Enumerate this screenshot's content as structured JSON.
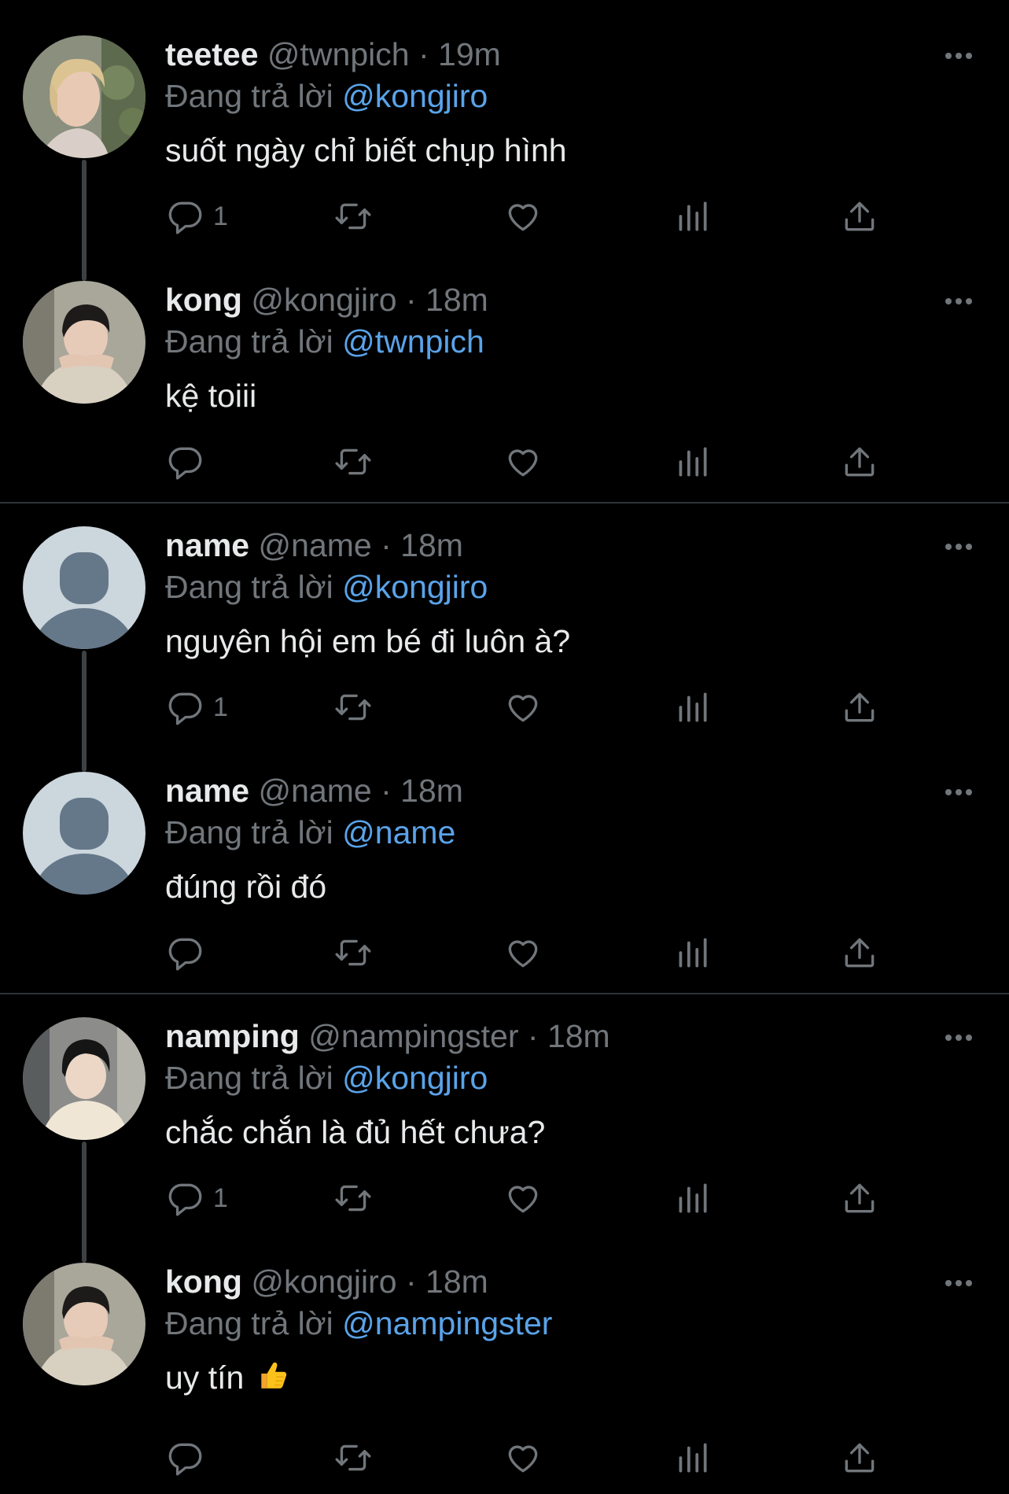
{
  "theme": {
    "background": "#000000",
    "text": "#e7e9ea",
    "muted": "#71767b",
    "link": "#5aa3e9",
    "thread_line": "#3e4144",
    "separator": "#2f3336"
  },
  "reply_prefix": "Đang trả lời",
  "tweets": [
    {
      "name": "teetee",
      "handle": "@twnpich",
      "time": "19m",
      "reply_to": "@kongjiro",
      "text": "suốt ngày chỉ biết chụp hình",
      "reply_count": "1",
      "avatar_icon": "photo-avatar-icon"
    },
    {
      "name": "kong",
      "handle": "@kongjiro",
      "time": "18m",
      "reply_to": "@twnpich",
      "text": "kệ toiii",
      "reply_count": "",
      "avatar_icon": "photo-avatar-icon"
    },
    {
      "name": "name",
      "handle": "@name",
      "time": "18m",
      "reply_to": "@kongjiro",
      "text": "nguyên hội em bé đi luôn à?",
      "reply_count": "1",
      "avatar_icon": "default-avatar-icon"
    },
    {
      "name": "name",
      "handle": "@name",
      "time": "18m",
      "reply_to": "@name",
      "text": "đúng rồi đó",
      "reply_count": "",
      "avatar_icon": "default-avatar-icon"
    },
    {
      "name": "namping",
      "handle": "@nampingster",
      "time": "18m",
      "reply_to": "@kongjiro",
      "text": "chắc chắn là đủ hết chưa?",
      "reply_count": "1",
      "avatar_icon": "photo-avatar-icon"
    },
    {
      "name": "kong",
      "handle": "@kongjiro",
      "time": "18m",
      "reply_to": "@nampingster",
      "text": "uy tín",
      "text_emoji": "thumbs-up-icon",
      "reply_count": "",
      "avatar_icon": "photo-avatar-icon"
    }
  ],
  "icons": {
    "more": "more-icon",
    "reply": "reply-icon",
    "retweet": "retweet-icon",
    "like": "like-icon",
    "views": "views-icon",
    "share": "share-icon"
  }
}
